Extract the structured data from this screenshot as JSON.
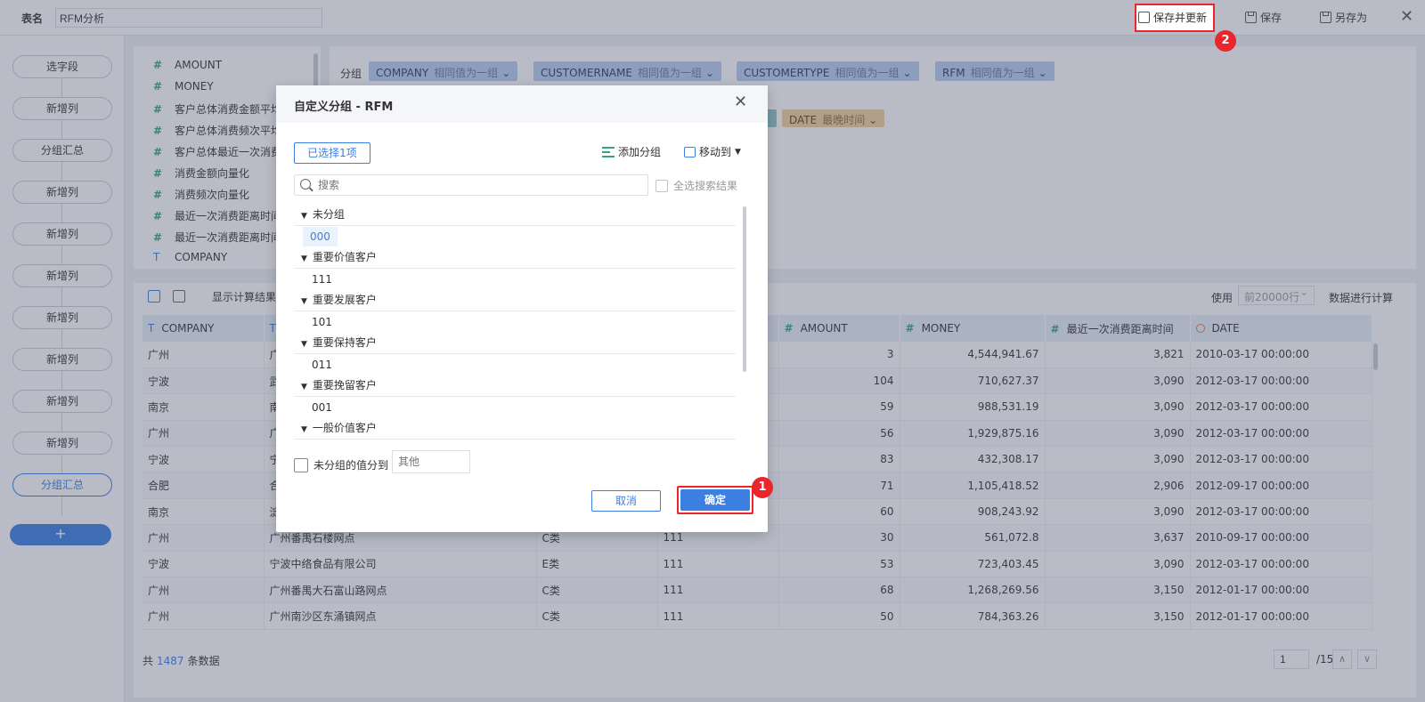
{
  "topbar": {
    "table_name_label": "表名",
    "table_name_value": "RFM分析",
    "save_update_label": "保存并更新",
    "save_label": "保存",
    "save_as_label": "另存为",
    "close_glyph": "✕"
  },
  "rail": {
    "items": [
      {
        "label": "选字段"
      },
      {
        "label": "新增列"
      },
      {
        "label": "分组汇总"
      },
      {
        "label": "新增列"
      },
      {
        "label": "新增列"
      },
      {
        "label": "新增列"
      },
      {
        "label": "新增列"
      },
      {
        "label": "新增列"
      },
      {
        "label": "新增列"
      },
      {
        "label": "新增列"
      },
      {
        "label": "分组汇总"
      }
    ],
    "add_glyph": "+"
  },
  "fields": [
    {
      "icon": "#",
      "name": "AMOUNT"
    },
    {
      "icon": "#",
      "name": "MONEY"
    },
    {
      "icon": "#",
      "name": "客户总体消费金额平均"
    },
    {
      "icon": "#",
      "name": "客户总体消费频次平均"
    },
    {
      "icon": "#",
      "name": "客户总体最近一次消费"
    },
    {
      "icon": "#",
      "name": "消费金额向量化"
    },
    {
      "icon": "#",
      "name": "消费频次向量化"
    },
    {
      "icon": "#",
      "name": "最近一次消费距离时间"
    },
    {
      "icon": "#",
      "name": "最近一次消费距离时间"
    },
    {
      "icon": "T",
      "name": "COMPANY"
    }
  ],
  "grouping": {
    "label": "分组",
    "chips": [
      {
        "name": "COMPANY",
        "mode": "相同值为一组"
      },
      {
        "name": "CUSTOMERNAME",
        "mode": "相同值为一组"
      },
      {
        "name": "CUSTOMERTYPE",
        "mode": "相同值为一组"
      },
      {
        "name": "RFM",
        "mode": "相同值为一组"
      }
    ],
    "summary_chip": {
      "name": "DATE",
      "mode": "最晚时间"
    }
  },
  "datagrid": {
    "show_calc_label": "显示计算结果",
    "use_label": "使用",
    "rows_select": "前20000行",
    "calc_label": "数据进行计算",
    "columns": [
      {
        "icon": "T",
        "label": "COMPANY"
      },
      {
        "icon": "T",
        "label": ""
      },
      {
        "icon": "",
        "label": ""
      },
      {
        "icon": "",
        "label": ""
      },
      {
        "icon": "#",
        "label": "AMOUNT"
      },
      {
        "icon": "#",
        "label": "MONEY"
      },
      {
        "icon": "#",
        "label": "最近一次消费距离时间"
      },
      {
        "icon": "clock",
        "label": "DATE"
      }
    ],
    "rows": [
      [
        "广州",
        "广",
        "",
        "",
        "3",
        "4,544,941.67",
        "3,821",
        "2010-03-17 00:00:00"
      ],
      [
        "宁波",
        "武",
        "",
        "",
        "104",
        "710,627.37",
        "3,090",
        "2012-03-17 00:00:00"
      ],
      [
        "南京",
        "南",
        "",
        "",
        "59",
        "988,531.19",
        "3,090",
        "2012-03-17 00:00:00"
      ],
      [
        "广州",
        "广",
        "",
        "",
        "56",
        "1,929,875.16",
        "3,090",
        "2012-03-17 00:00:00"
      ],
      [
        "宁波",
        "宁",
        "",
        "",
        "83",
        "432,308.17",
        "3,090",
        "2012-03-17 00:00:00"
      ],
      [
        "合肥",
        "合",
        "",
        "",
        "71",
        "1,105,418.52",
        "2,906",
        "2012-09-17 00:00:00"
      ],
      [
        "南京",
        "淀",
        "",
        "",
        "60",
        "908,243.92",
        "3,090",
        "2012-03-17 00:00:00"
      ],
      [
        "广州",
        "广州番禺石楼网点",
        "C类",
        "111",
        "30",
        "561,072.8",
        "3,637",
        "2010-09-17 00:00:00"
      ],
      [
        "宁波",
        "宁波中络食品有限公司",
        "E类",
        "111",
        "53",
        "723,403.45",
        "3,090",
        "2012-03-17 00:00:00"
      ],
      [
        "广州",
        "广州番禺大石富山路网点",
        "C类",
        "111",
        "68",
        "1,268,269.56",
        "3,150",
        "2012-01-17 00:00:00"
      ],
      [
        "广州",
        "广州南沙区东涌镇网点",
        "C类",
        "111",
        "50",
        "784,363.26",
        "3,150",
        "2012-01-17 00:00:00"
      ]
    ],
    "footer_prefix": "共",
    "footer_count": "1487",
    "footer_suffix": "条数据",
    "page_current": "1",
    "page_total": "/15"
  },
  "dialog": {
    "title": "自定义分组 - RFM",
    "close_glyph": "✕",
    "selected_label": "已选择1项",
    "add_group_label": "添加分组",
    "move_to_label": "移动到",
    "search_placeholder": "搜索",
    "select_all_label": "全选搜索结果",
    "groups": [
      {
        "name": "未分组",
        "items": [
          "000"
        ]
      },
      {
        "name": "重要价值客户",
        "items": [
          "111"
        ]
      },
      {
        "name": "重要发展客户",
        "items": [
          "101"
        ]
      },
      {
        "name": "重要保持客户",
        "items": [
          "011"
        ]
      },
      {
        "name": "重要挽留客户",
        "items": [
          "001"
        ]
      },
      {
        "name": "一般价值客户",
        "items": []
      }
    ],
    "unassigned_label": "未分组的值分到",
    "other_placeholder": "其他",
    "cancel_label": "取消",
    "ok_label": "确定"
  },
  "annotations": {
    "badge_1": "1",
    "badge_2": "2"
  },
  "colors": {
    "accent": "#3d7fe0",
    "highlight": "#e8262b",
    "chip": "#b9cdf0"
  }
}
